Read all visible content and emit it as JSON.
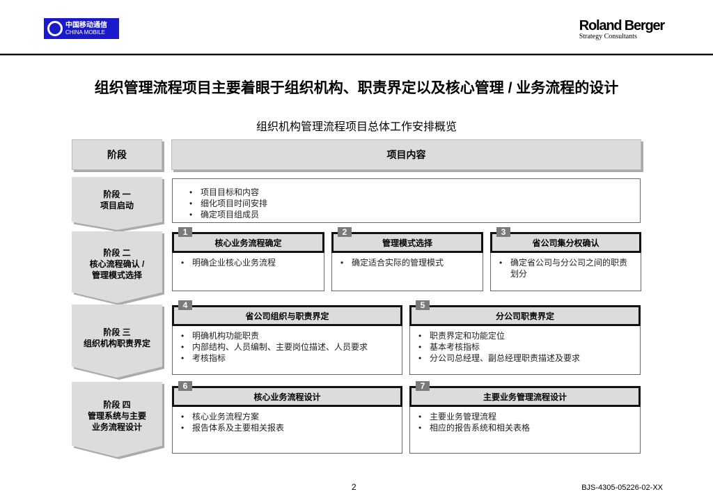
{
  "header": {
    "china_mobile_logo": {
      "cn": "中国移动通信",
      "en": "CHINA MOBILE"
    },
    "rb_logo": {
      "name": "Roland Berger",
      "tagline": "Strategy Consultants"
    }
  },
  "title": "组织管理流程项目主要着眼于组织机构、职责界定以及核心管理 / 业务流程的设计",
  "subtitle": "组织机构管理流程项目总体工作安排概览",
  "table": {
    "col_stage": "阶段",
    "col_content": "项目内容"
  },
  "stages": [
    {
      "line1": "阶段 一",
      "line2": "项目启动"
    },
    {
      "line1": "阶段 二",
      "line2": "核心流程确认 /",
      "line3": "管理模式选择"
    },
    {
      "line1": "阶段 三",
      "line2": "组织机构职责界定"
    },
    {
      "line1": "阶段 四",
      "line2": "管理系统与主要",
      "line3": "业务流程设计"
    }
  ],
  "stage1_items": [
    "项目目标和内容",
    "细化项目时间安排",
    "确定项目组成员"
  ],
  "cards": [
    {
      "num": "1",
      "title": "核心业务流程确定",
      "items": [
        "明确企业核心业务流程"
      ]
    },
    {
      "num": "2",
      "title": "管理模式选择",
      "items": [
        "确定适合实际的管理模式"
      ]
    },
    {
      "num": "3",
      "title": "省公司集分权确认",
      "items": [
        "确定省公司与分公司之间的职责划分"
      ]
    },
    {
      "num": "4",
      "title": "省公司组织与职责界定",
      "items": [
        "明确机构功能职责",
        "内部结构、人员编制、主要岗位描述、人员要求",
        "考核指标"
      ]
    },
    {
      "num": "5",
      "title": "分公司职责界定",
      "items": [
        "职责界定和功能定位",
        "基本考核指标",
        "分公司总经理、副总经理职责描述及要求"
      ]
    },
    {
      "num": "6",
      "title": "核心业务流程设计",
      "items": [
        "核心业务流程方案",
        "报告体系及主要相关报表"
      ]
    },
    {
      "num": "7",
      "title": "主要业务管理流程设计",
      "items": [
        "主要业务管理流程",
        "相应的报告系统和相关表格"
      ]
    }
  ],
  "footer": {
    "page": "2",
    "code": "BJS-4305-05226-02-XX"
  }
}
